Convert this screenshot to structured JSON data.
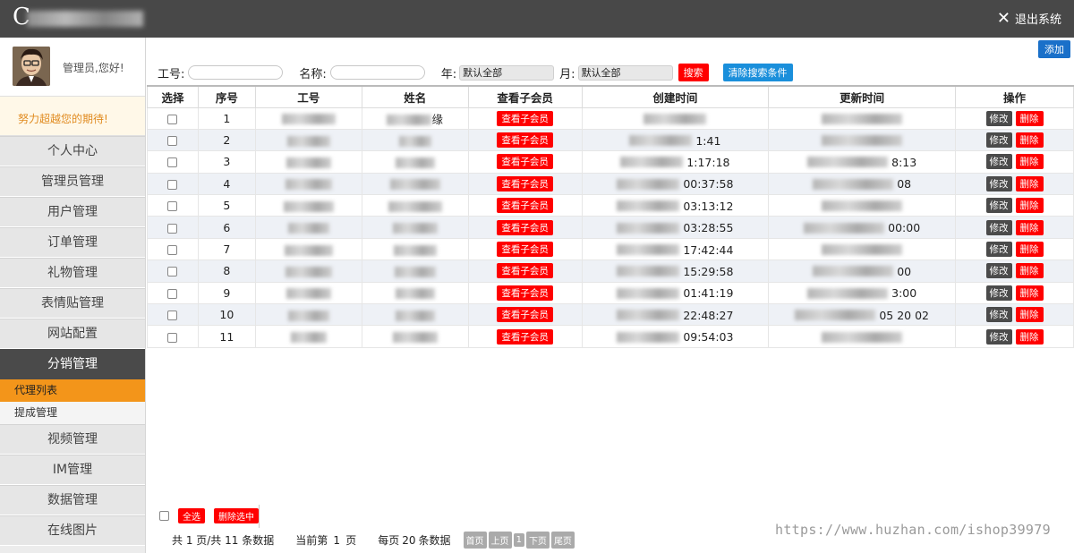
{
  "app": {
    "logo_char": "C",
    "logout_label": "退出系统"
  },
  "sidebar": {
    "greeting": "管理员,您好!",
    "slogan": "努力超越您的期待!",
    "items": [
      {
        "label": "个人中心"
      },
      {
        "label": "管理员管理"
      },
      {
        "label": "用户管理"
      },
      {
        "label": "订单管理"
      },
      {
        "label": "礼物管理"
      },
      {
        "label": "表情贴管理"
      },
      {
        "label": "网站配置"
      },
      {
        "label": "分销管理"
      },
      {
        "label": "视频管理"
      },
      {
        "label": "IM管理"
      },
      {
        "label": "数据管理"
      },
      {
        "label": "在线图片"
      }
    ],
    "sub_items": [
      {
        "label": "代理列表"
      },
      {
        "label": "提成管理"
      }
    ]
  },
  "toolbar": {
    "add_label": "添加"
  },
  "search": {
    "id_label": "工号:",
    "name_label": "名称:",
    "year_label": "年:",
    "year_value": "默认全部",
    "month_label": "月:",
    "month_value": "默认全部",
    "search_button": "搜索",
    "clear_button": "清除搜索条件"
  },
  "table": {
    "headers": [
      "选择",
      "序号",
      "工号",
      "姓名",
      "查看子会员",
      "创建时间",
      "更新时间",
      "操作"
    ],
    "view_label": "查看子会员",
    "edit_label": "修改",
    "delete_label": "删除",
    "rows": [
      {
        "index": "1",
        "name_suffix": "缘",
        "created": "",
        "updated": ""
      },
      {
        "index": "2",
        "name_suffix": "",
        "created": "1:41",
        "updated": ""
      },
      {
        "index": "3",
        "name_suffix": "",
        "created": "1:17:18",
        "updated": "8:13"
      },
      {
        "index": "4",
        "name_suffix": "",
        "created": "00:37:58",
        "updated": "08"
      },
      {
        "index": "5",
        "name_suffix": "",
        "created": "03:13:12",
        "updated": ""
      },
      {
        "index": "6",
        "name_suffix": "",
        "created": "03:28:55",
        "updated": "00:00"
      },
      {
        "index": "7",
        "name_suffix": "",
        "created": "17:42:44",
        "updated": ""
      },
      {
        "index": "8",
        "name_suffix": "",
        "created": "15:29:58",
        "updated": "00"
      },
      {
        "index": "9",
        "name_suffix": "",
        "created": "01:41:19",
        "updated": "3:00"
      },
      {
        "index": "10",
        "name_suffix": "",
        "created": "22:48:27",
        "updated": "05 20 02"
      },
      {
        "index": "11",
        "name_suffix": "",
        "created": "09:54:03",
        "updated": ""
      }
    ]
  },
  "footer": {
    "select_all": "全选",
    "delete_selected": "删除选中",
    "page_summary": "共 1 页/共 11 条数据",
    "current_prefix": "当前第",
    "current_page": "1",
    "current_suffix": "页",
    "per_page_prefix": "每页",
    "per_page": "20",
    "per_page_suffix": "条数据",
    "first": "首页",
    "prev": "上页",
    "page_num": "1",
    "next": "下页",
    "last": "尾页",
    "watermark": "https://www.huzhan.com/ishop39979"
  },
  "colors": {
    "topbar": "#484848",
    "active_menu": "#4a4a4a",
    "active_sub": "#f3951a",
    "danger": "#ff0000",
    "primary": "#1a70c9"
  }
}
